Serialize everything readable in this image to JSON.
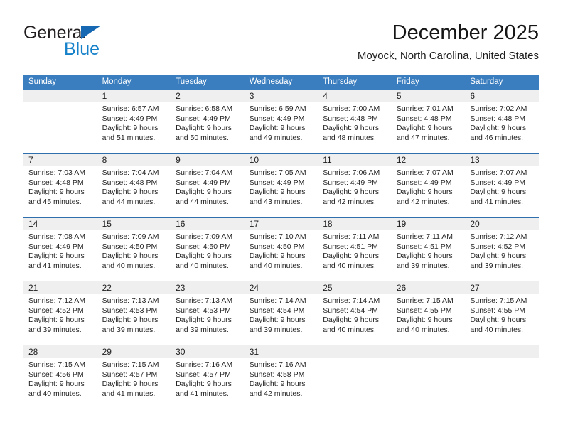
{
  "logo": {
    "text_primary": "General",
    "text_secondary": "Blue",
    "icon": "triangle-icon",
    "color_primary": "#231f20",
    "color_secondary": "#1681c9",
    "color_triangle": "#1668b3"
  },
  "header": {
    "title": "December 2025",
    "subtitle": "Moyock, North Carolina, United States"
  },
  "theme": {
    "header_blue": "#3b7ebf",
    "row_divider_blue": "#2f6fae",
    "daynum_strip_gray": "#efefef",
    "text_color": "#232323"
  },
  "weekday_headers": [
    "Sunday",
    "Monday",
    "Tuesday",
    "Wednesday",
    "Thursday",
    "Friday",
    "Saturday"
  ],
  "weeks": [
    [
      {
        "day": "",
        "blank": true,
        "lines": [
          "",
          "",
          "",
          ""
        ]
      },
      {
        "day": "1",
        "lines": [
          "Sunrise: 6:57 AM",
          "Sunset: 4:49 PM",
          "Daylight: 9 hours",
          "and 51 minutes."
        ]
      },
      {
        "day": "2",
        "lines": [
          "Sunrise: 6:58 AM",
          "Sunset: 4:49 PM",
          "Daylight: 9 hours",
          "and 50 minutes."
        ]
      },
      {
        "day": "3",
        "lines": [
          "Sunrise: 6:59 AM",
          "Sunset: 4:49 PM",
          "Daylight: 9 hours",
          "and 49 minutes."
        ]
      },
      {
        "day": "4",
        "lines": [
          "Sunrise: 7:00 AM",
          "Sunset: 4:48 PM",
          "Daylight: 9 hours",
          "and 48 minutes."
        ]
      },
      {
        "day": "5",
        "lines": [
          "Sunrise: 7:01 AM",
          "Sunset: 4:48 PM",
          "Daylight: 9 hours",
          "and 47 minutes."
        ]
      },
      {
        "day": "6",
        "lines": [
          "Sunrise: 7:02 AM",
          "Sunset: 4:48 PM",
          "Daylight: 9 hours",
          "and 46 minutes."
        ]
      }
    ],
    [
      {
        "day": "7",
        "lines": [
          "Sunrise: 7:03 AM",
          "Sunset: 4:48 PM",
          "Daylight: 9 hours",
          "and 45 minutes."
        ]
      },
      {
        "day": "8",
        "lines": [
          "Sunrise: 7:04 AM",
          "Sunset: 4:48 PM",
          "Daylight: 9 hours",
          "and 44 minutes."
        ]
      },
      {
        "day": "9",
        "lines": [
          "Sunrise: 7:04 AM",
          "Sunset: 4:49 PM",
          "Daylight: 9 hours",
          "and 44 minutes."
        ]
      },
      {
        "day": "10",
        "lines": [
          "Sunrise: 7:05 AM",
          "Sunset: 4:49 PM",
          "Daylight: 9 hours",
          "and 43 minutes."
        ]
      },
      {
        "day": "11",
        "lines": [
          "Sunrise: 7:06 AM",
          "Sunset: 4:49 PM",
          "Daylight: 9 hours",
          "and 42 minutes."
        ]
      },
      {
        "day": "12",
        "lines": [
          "Sunrise: 7:07 AM",
          "Sunset: 4:49 PM",
          "Daylight: 9 hours",
          "and 42 minutes."
        ]
      },
      {
        "day": "13",
        "lines": [
          "Sunrise: 7:07 AM",
          "Sunset: 4:49 PM",
          "Daylight: 9 hours",
          "and 41 minutes."
        ]
      }
    ],
    [
      {
        "day": "14",
        "lines": [
          "Sunrise: 7:08 AM",
          "Sunset: 4:49 PM",
          "Daylight: 9 hours",
          "and 41 minutes."
        ]
      },
      {
        "day": "15",
        "lines": [
          "Sunrise: 7:09 AM",
          "Sunset: 4:50 PM",
          "Daylight: 9 hours",
          "and 40 minutes."
        ]
      },
      {
        "day": "16",
        "lines": [
          "Sunrise: 7:09 AM",
          "Sunset: 4:50 PM",
          "Daylight: 9 hours",
          "and 40 minutes."
        ]
      },
      {
        "day": "17",
        "lines": [
          "Sunrise: 7:10 AM",
          "Sunset: 4:50 PM",
          "Daylight: 9 hours",
          "and 40 minutes."
        ]
      },
      {
        "day": "18",
        "lines": [
          "Sunrise: 7:11 AM",
          "Sunset: 4:51 PM",
          "Daylight: 9 hours",
          "and 40 minutes."
        ]
      },
      {
        "day": "19",
        "lines": [
          "Sunrise: 7:11 AM",
          "Sunset: 4:51 PM",
          "Daylight: 9 hours",
          "and 39 minutes."
        ]
      },
      {
        "day": "20",
        "lines": [
          "Sunrise: 7:12 AM",
          "Sunset: 4:52 PM",
          "Daylight: 9 hours",
          "and 39 minutes."
        ]
      }
    ],
    [
      {
        "day": "21",
        "lines": [
          "Sunrise: 7:12 AM",
          "Sunset: 4:52 PM",
          "Daylight: 9 hours",
          "and 39 minutes."
        ]
      },
      {
        "day": "22",
        "lines": [
          "Sunrise: 7:13 AM",
          "Sunset: 4:53 PM",
          "Daylight: 9 hours",
          "and 39 minutes."
        ]
      },
      {
        "day": "23",
        "lines": [
          "Sunrise: 7:13 AM",
          "Sunset: 4:53 PM",
          "Daylight: 9 hours",
          "and 39 minutes."
        ]
      },
      {
        "day": "24",
        "lines": [
          "Sunrise: 7:14 AM",
          "Sunset: 4:54 PM",
          "Daylight: 9 hours",
          "and 39 minutes."
        ]
      },
      {
        "day": "25",
        "lines": [
          "Sunrise: 7:14 AM",
          "Sunset: 4:54 PM",
          "Daylight: 9 hours",
          "and 40 minutes."
        ]
      },
      {
        "day": "26",
        "lines": [
          "Sunrise: 7:15 AM",
          "Sunset: 4:55 PM",
          "Daylight: 9 hours",
          "and 40 minutes."
        ]
      },
      {
        "day": "27",
        "lines": [
          "Sunrise: 7:15 AM",
          "Sunset: 4:55 PM",
          "Daylight: 9 hours",
          "and 40 minutes."
        ]
      }
    ],
    [
      {
        "day": "28",
        "lines": [
          "Sunrise: 7:15 AM",
          "Sunset: 4:56 PM",
          "Daylight: 9 hours",
          "and 40 minutes."
        ]
      },
      {
        "day": "29",
        "lines": [
          "Sunrise: 7:15 AM",
          "Sunset: 4:57 PM",
          "Daylight: 9 hours",
          "and 41 minutes."
        ]
      },
      {
        "day": "30",
        "lines": [
          "Sunrise: 7:16 AM",
          "Sunset: 4:57 PM",
          "Daylight: 9 hours",
          "and 41 minutes."
        ]
      },
      {
        "day": "31",
        "lines": [
          "Sunrise: 7:16 AM",
          "Sunset: 4:58 PM",
          "Daylight: 9 hours",
          "and 42 minutes."
        ]
      },
      {
        "day": "",
        "blank": true,
        "lines": [
          "",
          "",
          "",
          ""
        ]
      },
      {
        "day": "",
        "blank": true,
        "lines": [
          "",
          "",
          "",
          ""
        ]
      },
      {
        "day": "",
        "blank": true,
        "lines": [
          "",
          "",
          "",
          ""
        ]
      }
    ]
  ]
}
